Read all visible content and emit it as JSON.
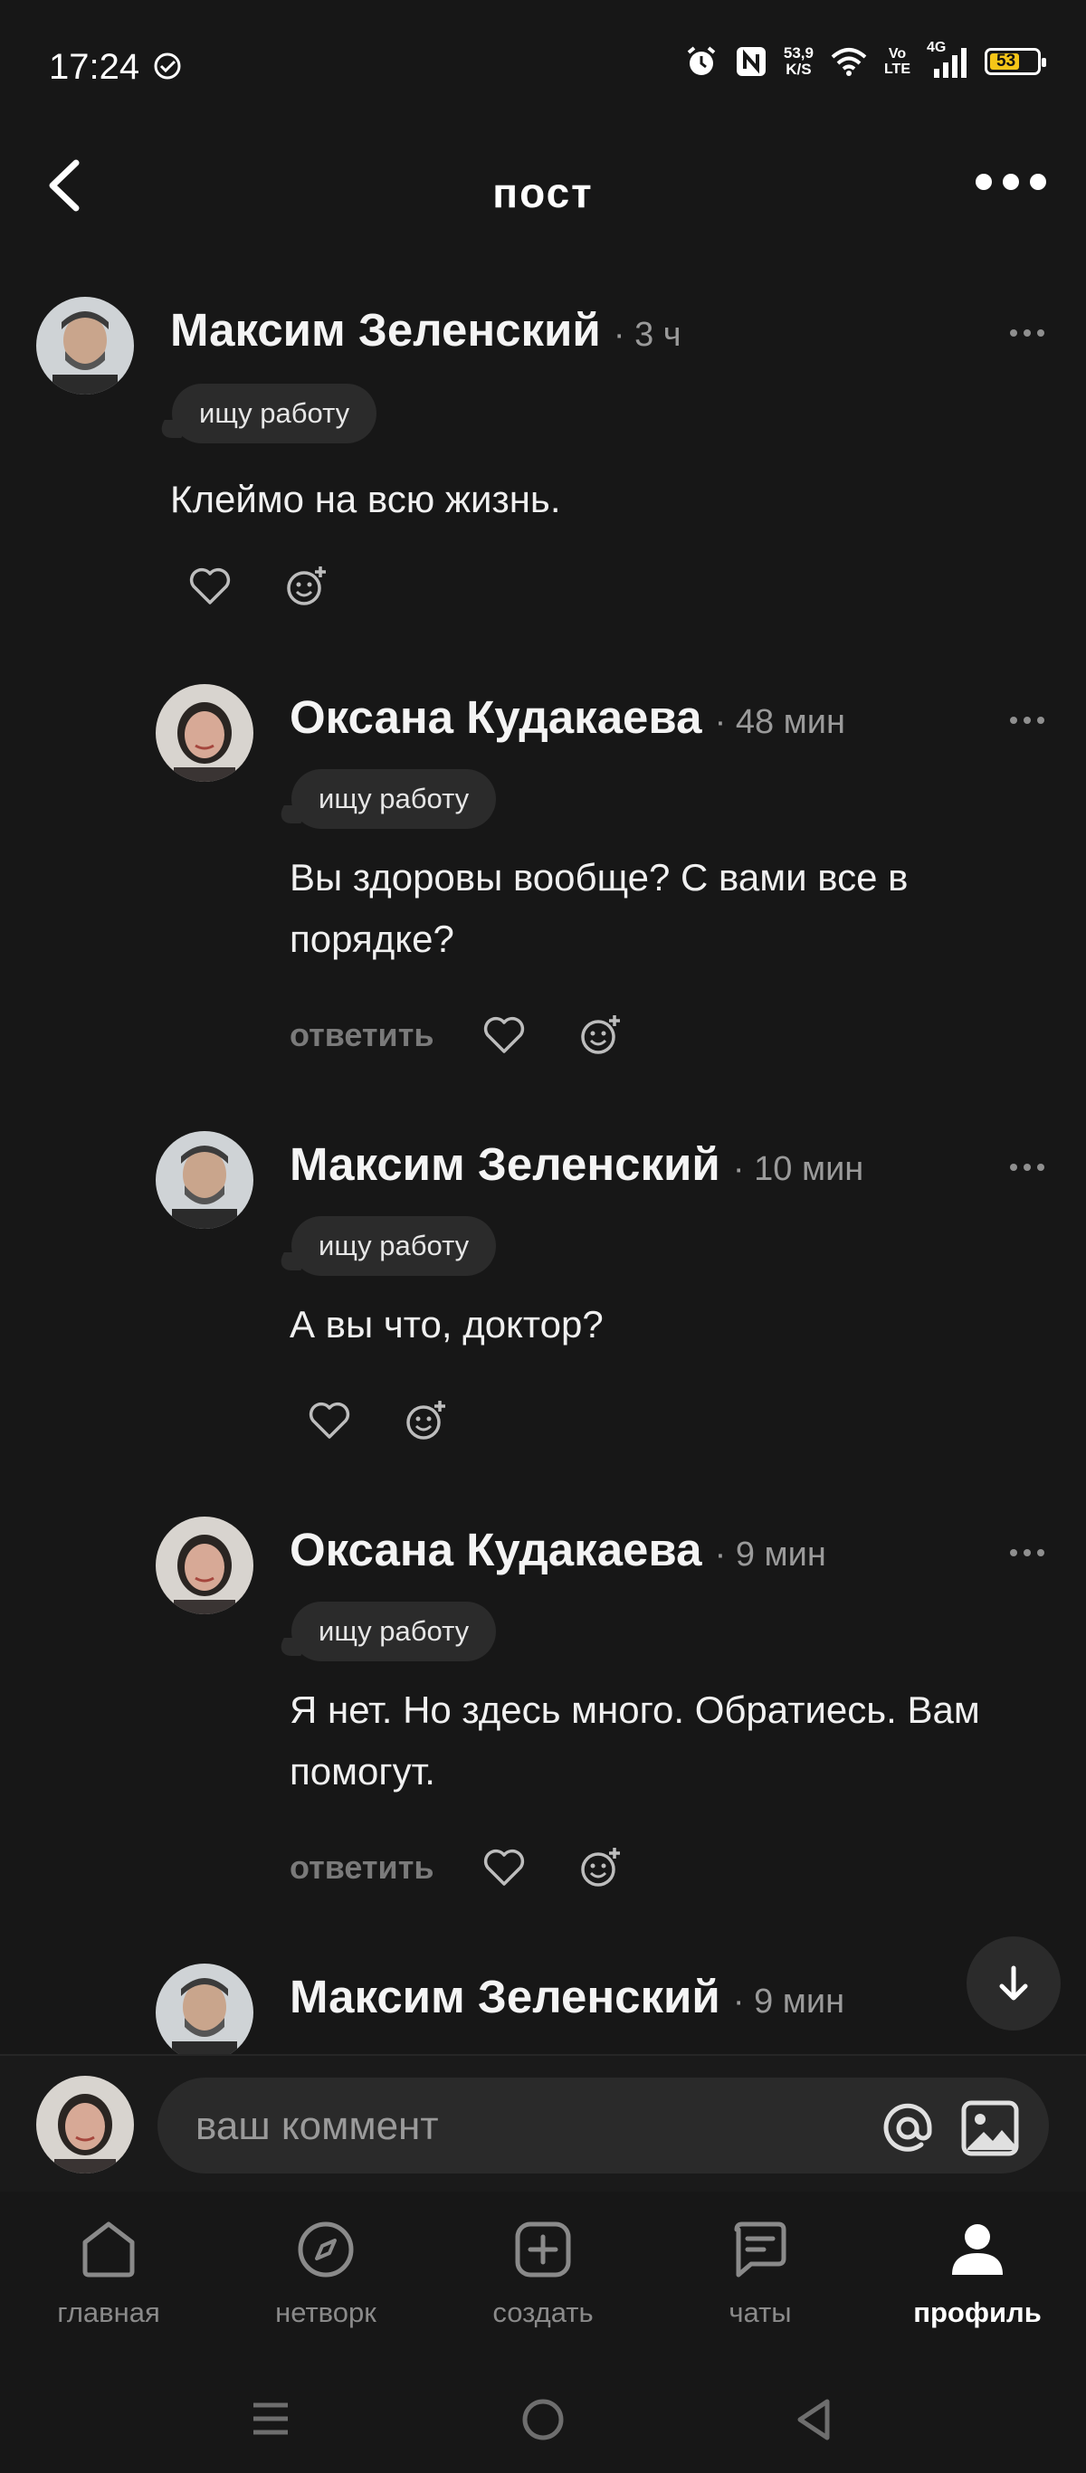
{
  "status_bar": {
    "time": "17:24",
    "speed_value": "53,9",
    "speed_unit": "K/S",
    "volte_top": "Vo",
    "volte_bottom": "LTE",
    "network": "4G",
    "battery": "53"
  },
  "header": {
    "title": "пост"
  },
  "comments": [
    {
      "author": "Максим Зеленский",
      "time": "· 3 ч",
      "badge": "ищу работу",
      "text": "Клеймо на всю жизнь."
    },
    {
      "author": "Оксана Кудакаева",
      "time": "· 48 мин",
      "badge": "ищу работу",
      "text": "Вы здоровы вообще? С вами все в порядке?",
      "reply": "ответить"
    },
    {
      "author": "Максим Зеленский",
      "time": "· 10 мин",
      "badge": "ищу работу",
      "text": "А вы что, доктор?"
    },
    {
      "author": "Оксана Кудакаева",
      "time": "· 9 мин",
      "badge": "ищу работу",
      "text": "Я нет. Но здесь много. Обратиесь. Вам помогут.",
      "reply": "ответить"
    },
    {
      "author": "Максим Зеленский",
      "time": "· 9 мин"
    }
  ],
  "composer": {
    "placeholder": "ваш коммент"
  },
  "nav": {
    "items": [
      {
        "label": "главная",
        "icon": "home-icon"
      },
      {
        "label": "нетворк",
        "icon": "compass-icon"
      },
      {
        "label": "создать",
        "icon": "plus-square-icon"
      },
      {
        "label": "чаты",
        "icon": "chat-icon"
      },
      {
        "label": "профиль",
        "icon": "profile-icon",
        "active": true
      }
    ]
  },
  "colors": {
    "background": "#171717",
    "badge": "#2b2b2b",
    "muted": "#8a8a8a"
  }
}
